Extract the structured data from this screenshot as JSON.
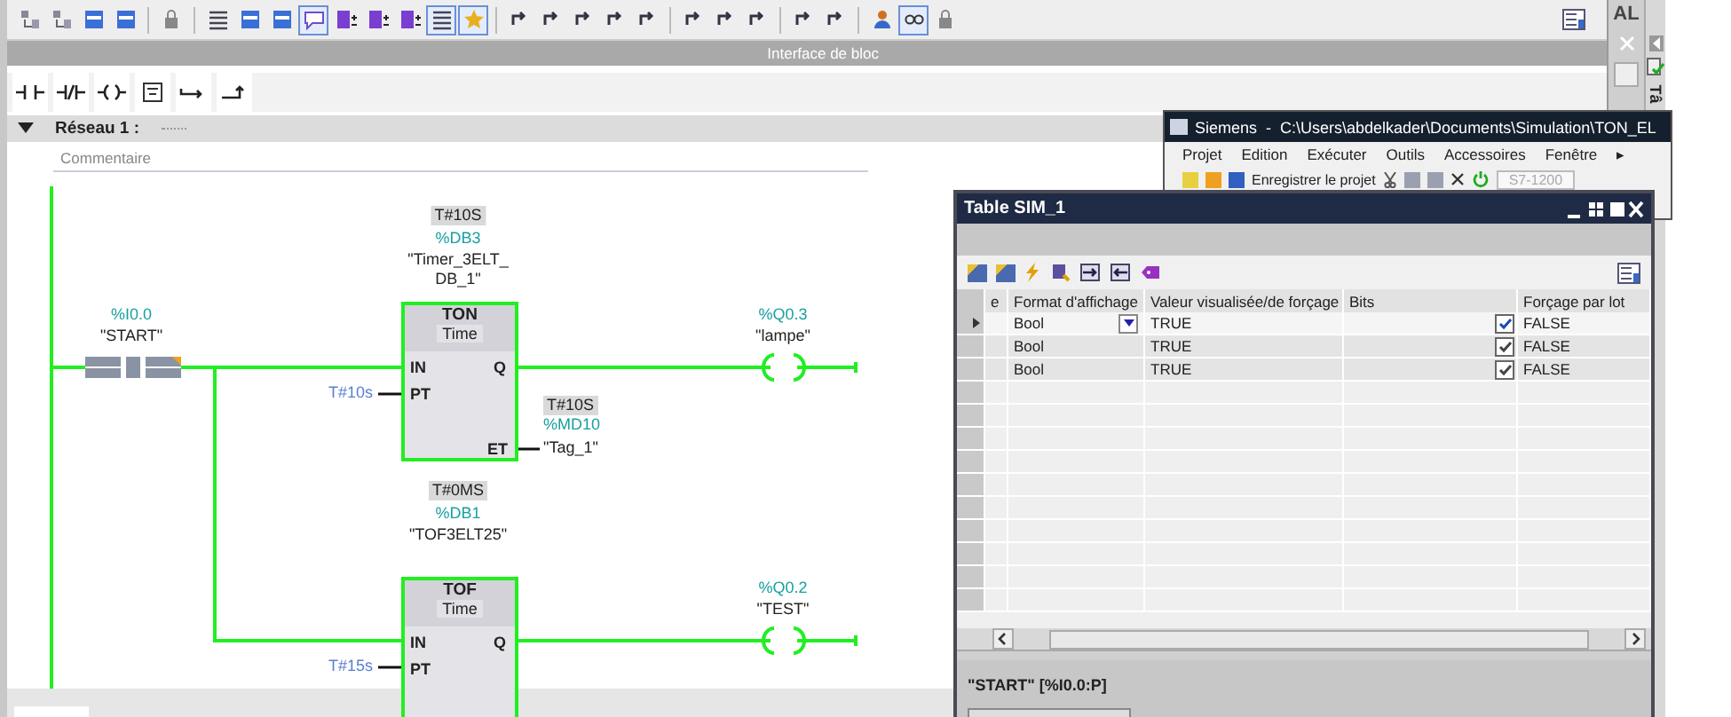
{
  "toolbar": {
    "buttons": [
      {
        "on": false
      },
      {
        "on": false
      },
      {
        "on": false
      },
      {
        "on": false
      },
      {
        "on": false
      },
      {
        "on": false
      },
      {
        "on": false
      },
      {
        "on": false
      },
      {
        "on": true
      },
      {
        "on": false
      },
      {
        "on": false
      },
      {
        "on": false
      },
      {
        "on": true
      },
      {
        "on": true
      },
      {
        "on": false
      },
      {
        "on": false
      },
      {
        "on": false
      },
      {
        "on": false
      },
      {
        "on": false
      },
      {
        "on": false
      },
      {
        "on": false
      },
      {
        "on": false
      },
      {
        "on": false
      },
      {
        "on": false
      },
      {
        "on": false
      },
      {
        "on": true
      },
      {
        "on": false
      }
    ]
  },
  "block_interface": "Interface de bloc",
  "network": {
    "title": "Réseau 1 :",
    "expanded": true,
    "comment_placeholder": "Commentaire"
  },
  "ladder": {
    "contact": {
      "address": "%I0.0",
      "tag": "\"START\""
    },
    "blocks": [
      {
        "type": "TON",
        "subtitle": "Time",
        "current_value": "T#10S",
        "db": "%DB3",
        "db_name": "\"Timer_3ELT_DB_1\"",
        "pins": {
          "in": "IN",
          "pt": "PT",
          "q": "Q",
          "et": "ET"
        },
        "pt_value": "T#10s",
        "et_output": {
          "value": "T#10S",
          "address": "%MD10",
          "tag": "\"Tag_1\""
        },
        "coil": {
          "address": "%Q0.3",
          "tag": "\"lampe\""
        }
      },
      {
        "type": "TOF",
        "subtitle": "Time",
        "current_value": "T#0MS",
        "db": "%DB1",
        "db_name": "\"TOF3ELT25\"",
        "pins": {
          "in": "IN",
          "pt": "PT",
          "q": "Q"
        },
        "pt_value": "T#15s",
        "coil": {
          "address": "%Q0.2",
          "tag": "\"TEST\""
        }
      }
    ]
  },
  "side_panel": {
    "title": "AL",
    "tab": "Tâ"
  },
  "siemens_window": {
    "title": "Siemens  -  C:\\Users\\abdelkader\\Documents\\Simulation\\TON_EL",
    "menu": [
      "Projet",
      "Edition",
      "Exécuter",
      "Outils",
      "Accessoires",
      "Fenêtre",
      "▸"
    ],
    "save_label": "Enregistrer le projet",
    "device": "S7-1200"
  },
  "sim_table": {
    "title": "Table SIM_1",
    "columns": [
      "e",
      "Format d'affichage",
      "Valeur visualisée/de forçage",
      "Bits",
      "Forçage par lot"
    ],
    "rows": [
      {
        "selected": true,
        "format": "Bool",
        "value": "TRUE",
        "bit_checked": true,
        "force": "FALSE"
      },
      {
        "selected": false,
        "format": "Bool",
        "value": "TRUE",
        "bit_checked": true,
        "force": "FALSE"
      },
      {
        "selected": false,
        "format": "Bool",
        "value": "TRUE",
        "bit_checked": true,
        "force": "FALSE"
      }
    ],
    "status": "\"START\" [%I0.0:P]"
  }
}
